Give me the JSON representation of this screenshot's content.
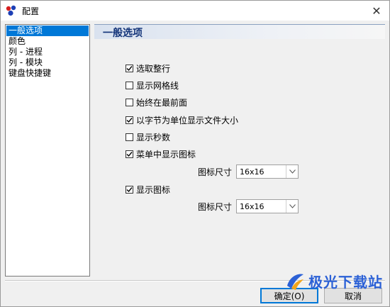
{
  "window": {
    "title": "配置"
  },
  "nav": {
    "items": [
      {
        "label": "一般选项",
        "selected": true
      },
      {
        "label": "颜色",
        "selected": false
      },
      {
        "label": "列 - 进程",
        "selected": false
      },
      {
        "label": "列 - 模块",
        "selected": false
      },
      {
        "label": "键盘快捷键",
        "selected": false
      }
    ]
  },
  "panel": {
    "title": "一般选项",
    "options": [
      {
        "label": "选取整行",
        "checked": true
      },
      {
        "label": "显示网格线",
        "checked": false
      },
      {
        "label": "始终在最前面",
        "checked": false
      },
      {
        "label": "以字节为单位显示文件大小",
        "checked": true
      },
      {
        "label": "显示秒数",
        "checked": false
      },
      {
        "label": "菜单中显示图标",
        "checked": true
      },
      {
        "label": "显示图标",
        "checked": true
      }
    ],
    "menu_icon_size": {
      "label": "图标尺寸",
      "value": "16x16"
    },
    "icon_size": {
      "label": "图标尺寸",
      "value": "16x16"
    }
  },
  "buttons": {
    "ok": "确定(O)",
    "cancel": "取消"
  },
  "watermark": {
    "text": "极光下载站"
  },
  "colors": {
    "accent": "#0078d7",
    "header_text": "#14357a",
    "watermark": "#2c61d6"
  }
}
